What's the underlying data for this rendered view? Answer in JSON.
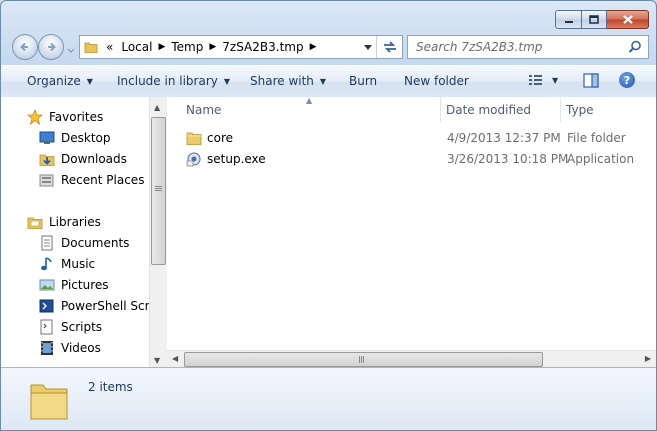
{
  "window": {
    "caption_buttons": {
      "minimize": "minimize-icon",
      "maximize": "maximize-icon",
      "close": "close-icon"
    }
  },
  "address_bar": {
    "overflow": "«",
    "crumbs": [
      "Local",
      "Temp",
      "7zSA2B3.tmp"
    ]
  },
  "search": {
    "placeholder": "Search 7zSA2B3.tmp"
  },
  "toolbar": {
    "organize": "Organize",
    "include_in_library": "Include in library",
    "share_with": "Share with",
    "burn": "Burn",
    "new_folder": "New folder",
    "help": "?"
  },
  "nav_pane": {
    "favorites": {
      "label": "Favorites",
      "items": [
        "Desktop",
        "Downloads",
        "Recent Places"
      ]
    },
    "libraries": {
      "label": "Libraries",
      "items": [
        "Documents",
        "Music",
        "Pictures",
        "PowerShell Scripts",
        "Scripts",
        "Videos"
      ]
    }
  },
  "file_list": {
    "columns": [
      "Name",
      "Date modified",
      "Type"
    ],
    "rows": [
      {
        "name": "core",
        "date": "4/9/2013 12:37 PM",
        "type": "File folder",
        "icon": "folder-icon"
      },
      {
        "name": "setup.exe",
        "date": "3/26/2013 10:18 PM",
        "type": "Application",
        "icon": "application-icon"
      }
    ]
  },
  "details_pane": {
    "count": "2 items"
  },
  "colors": {
    "accent": "#1e395b",
    "toolbar_bg": "#dce7f4",
    "close": "#c2432a"
  }
}
